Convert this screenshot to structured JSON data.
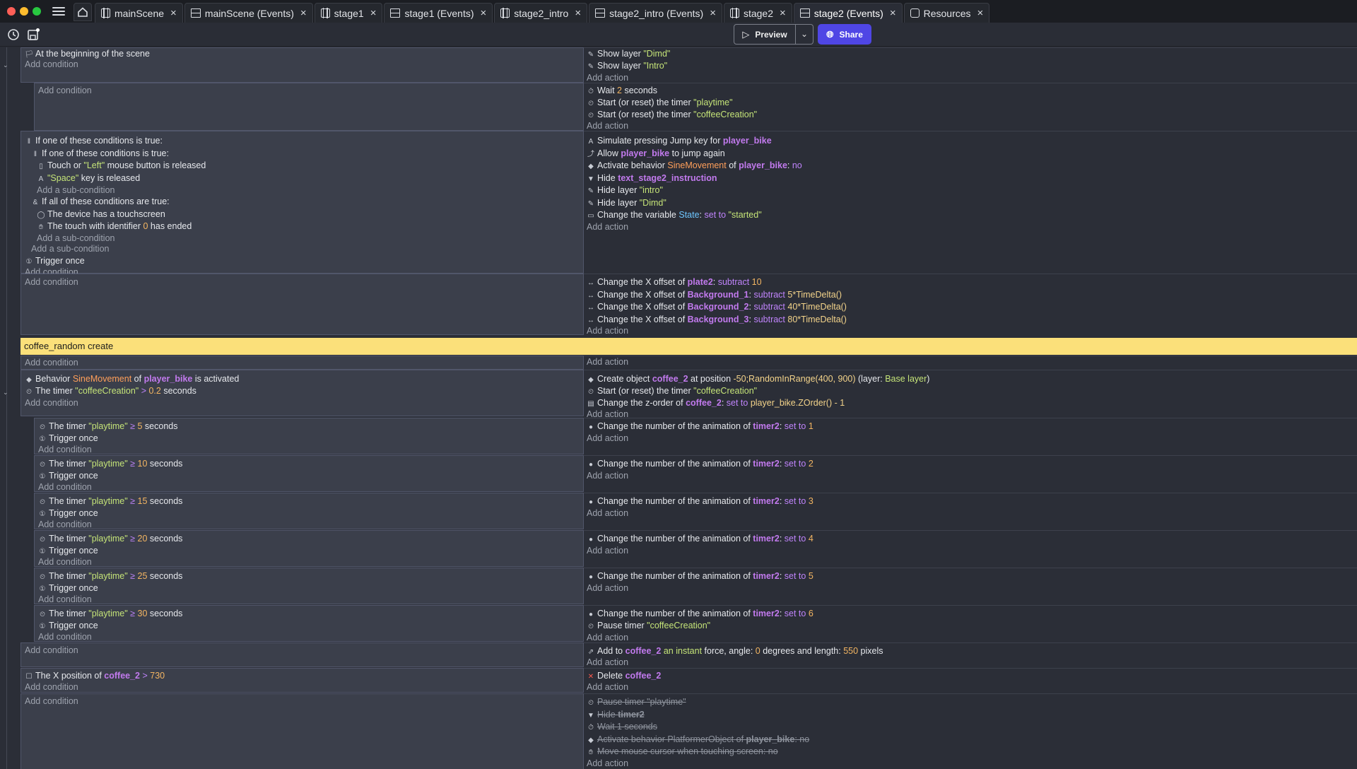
{
  "window": {
    "tabs": [
      {
        "label": "mainScene",
        "kind": "scene"
      },
      {
        "label": "mainScene (Events)",
        "kind": "events"
      },
      {
        "label": "stage1",
        "kind": "scene"
      },
      {
        "label": "stage1 (Events)",
        "kind": "events"
      },
      {
        "label": "stage2_intro",
        "kind": "scene"
      },
      {
        "label": "stage2_intro (Events)",
        "kind": "events"
      },
      {
        "label": "stage2",
        "kind": "scene"
      },
      {
        "label": "stage2 (Events)",
        "kind": "events",
        "active": true
      },
      {
        "label": "Resources",
        "kind": "resources"
      }
    ]
  },
  "toolbar": {
    "preview_label": "Preview",
    "share_label": "Share",
    "accent_color": "#4f46e5"
  },
  "events": {
    "ev1": {
      "c1": "At the beginning of the scene",
      "add_condition": "Add condition",
      "a1_pre": "Show layer ",
      "a1_s": "\"Dimd\"",
      "a2_pre": "Show layer ",
      "a2_s": "\"Intro\"",
      "add_action": "Add action"
    },
    "ev2": {
      "add_condition": "Add condition",
      "a1_pre": "Wait ",
      "a1_n": "2",
      "a1_post": " seconds",
      "a2_pre": "Start (or reset) the timer ",
      "a2_s": "\"playtime\"",
      "a3_pre": "Start (or reset) the timer ",
      "a3_s": "\"coffeeCreation\"",
      "add_action": "Add action"
    },
    "ev3": {
      "c1": "If one of these conditions is true:",
      "c2": "If one of these conditions is true:",
      "c3_pre": "Touch or ",
      "c3_s": "\"Left\"",
      "c3_post": " mouse button is released",
      "c4_s": "\"Space\"",
      "c4_post": " key is released",
      "add_sub1": "Add a sub-condition",
      "c5": "If all of these conditions are true:",
      "c6": "The device has a touchscreen",
      "c7_pre": "The touch with identifier ",
      "c7_n": "0",
      "c7_post": " has ended",
      "add_sub2": "Add a sub-condition",
      "add_sub3": "Add a sub-condition",
      "c8": "Trigger once",
      "add_condition": "Add condition",
      "a1_pre": "Simulate pressing Jump key for ",
      "a1_o": "player_bike",
      "a2_pre": "Allow ",
      "a2_o": "player_bike",
      "a2_post": " to jump again",
      "a3_pre": "Activate behavior ",
      "a3_b": "SineMovement",
      "a3_mid": " of ",
      "a3_o": "player_bike",
      "a3_post": ": ",
      "a3_op": "no",
      "a4_pre": "Hide ",
      "a4_o": "text_stage2_instruction",
      "a5_pre": "Hide layer ",
      "a5_s": "\"intro\"",
      "a6_pre": "Hide layer ",
      "a6_s": "\"Dimd\"",
      "a7_pre": "Change the variable ",
      "a7_v": "State",
      "a7_mid": ": ",
      "a7_op": "set to",
      "a7_s": " \"started\"",
      "add_action": "Add action"
    },
    "ev4": {
      "add_condition": "Add condition",
      "a1_pre": "Change the X offset of ",
      "a1_o": "plate2",
      "a1_mid": ": ",
      "a1_op": "subtract",
      "a1_n": " 10",
      "a2_pre": "Change the X offset of ",
      "a2_o": "Background_1",
      "a2_mid": ": ",
      "a2_op": "subtract",
      "a2_n": " 5*TimeDelta()",
      "a3_pre": "Change the X offset of ",
      "a3_o": "Background_2",
      "a3_mid": ": ",
      "a3_op": "subtract",
      "a3_n": " 40*TimeDelta()",
      "a4_pre": "Change the X offset of ",
      "a4_o": "Background_3",
      "a4_mid": ": ",
      "a4_op": "subtract",
      "a4_n": " 80*TimeDelta()",
      "add_action": "Add action"
    },
    "comment": "coffee_random create",
    "ev5": {
      "add_condition": "Add condition",
      "add_action": "Add action"
    },
    "ev6": {
      "c1_pre": "Behavior ",
      "c1_b": "SineMovement",
      "c1_mid": " of ",
      "c1_o": "player_bike",
      "c1_post": " is activated",
      "c2_pre": "The timer ",
      "c2_s": "\"coffeeCreation\"",
      "c2_op": " > ",
      "c2_n": "0.2",
      "c2_post": " seconds",
      "add_condition": "Add condition",
      "a1_pre": "Create object ",
      "a1_o": "coffee_2",
      "a1_mid": " at position ",
      "a1_e": "-50;RandomInRange(400, 900)",
      "a1_l": " (layer: ",
      "a1_s": "Base layer",
      "a1_end": ")",
      "a2_pre": "Start (or reset) the timer ",
      "a2_s": "\"coffeeCreation\"",
      "a3_pre": "Change the z-order of ",
      "a3_o": "coffee_2",
      "a3_mid": ": ",
      "a3_op": "set to",
      "a3_e": " player_bike.ZOrder() - 1",
      "add_action": "Add action"
    },
    "timers": [
      {
        "c_pre": "The timer ",
        "c_s": "\"playtime\"",
        "c_op": " ≥ ",
        "c_n": "5",
        "c_post": " seconds",
        "trigger": "Trigger once",
        "add_condition": "Add condition",
        "a_pre": "Change the number of the animation of ",
        "a_o": "timer2",
        "a_mid": ": ",
        "a_op": "set to",
        "a_n": " 1",
        "add_action": "Add action"
      },
      {
        "c_pre": "The timer ",
        "c_s": "\"playtime\"",
        "c_op": " ≥ ",
        "c_n": "10",
        "c_post": " seconds",
        "trigger": "Trigger once",
        "add_condition": "Add condition",
        "a_pre": "Change the number of the animation of ",
        "a_o": "timer2",
        "a_mid": ": ",
        "a_op": "set to",
        "a_n": " 2",
        "add_action": "Add action"
      },
      {
        "c_pre": "The timer ",
        "c_s": "\"playtime\"",
        "c_op": " ≥ ",
        "c_n": "15",
        "c_post": " seconds",
        "trigger": "Trigger once",
        "add_condition": "Add condition",
        "a_pre": "Change the number of the animation of ",
        "a_o": "timer2",
        "a_mid": ": ",
        "a_op": "set to",
        "a_n": " 3",
        "add_action": "Add action"
      },
      {
        "c_pre": "The timer ",
        "c_s": "\"playtime\"",
        "c_op": " ≥ ",
        "c_n": "20",
        "c_post": " seconds",
        "trigger": "Trigger once",
        "add_condition": "Add condition",
        "a_pre": "Change the number of the animation of ",
        "a_o": "timer2",
        "a_mid": ": ",
        "a_op": "set to",
        "a_n": " 4",
        "add_action": "Add action"
      },
      {
        "c_pre": "The timer ",
        "c_s": "\"playtime\"",
        "c_op": " ≥ ",
        "c_n": "25",
        "c_post": " seconds",
        "trigger": "Trigger once",
        "add_condition": "Add condition",
        "a_pre": "Change the number of the animation of ",
        "a_o": "timer2",
        "a_mid": ": ",
        "a_op": "set to",
        "a_n": " 5",
        "add_action": "Add action"
      },
      {
        "c_pre": "The timer ",
        "c_s": "\"playtime\"",
        "c_op": " ≥ ",
        "c_n": "30",
        "c_post": " seconds",
        "trigger": "Trigger once",
        "add_condition": "Add condition",
        "a_pre": "Change the number of the animation of ",
        "a_o": "timer2",
        "a_mid": ": ",
        "a_op": "set to",
        "a_n": " 6",
        "add_action": "Add action",
        "a2_pre": "Pause timer ",
        "a2_s": "\"coffeeCreation\""
      }
    ],
    "ev13": {
      "add_condition": "Add condition",
      "a1_pre": "Add to ",
      "a1_o": "coffee_2",
      "a1_b": " an instant",
      "a1_mid": " force, angle: ",
      "a1_n1": "0",
      "a1_mid2": " degrees and length: ",
      "a1_n2": "550",
      "a1_post": " pixels",
      "add_action": "Add action"
    },
    "ev14": {
      "c1_pre": "The X position of ",
      "c1_o": "coffee_2",
      "c1_op": " > ",
      "c1_n": "730",
      "add_condition": "Add condition",
      "a1_pre": "Delete ",
      "a1_o": "coffee_2",
      "add_action": "Add action"
    },
    "ev15": {
      "add_condition": "Add condition",
      "a1_pre": "Pause timer ",
      "a1_s": "\"playtime\"",
      "a2_pre": "Hide ",
      "a2_o": "timer2",
      "a3_pre": "Wait ",
      "a3_n": "1",
      "a3_post": " seconds",
      "a4_pre": "Activate behavior ",
      "a4_b": "PlatformerObject",
      "a4_mid": " of ",
      "a4_o": "player_bike",
      "a4_post": ": no",
      "a5": "Move mouse cursor when touching screen: no",
      "add_action": "Add action"
    }
  }
}
